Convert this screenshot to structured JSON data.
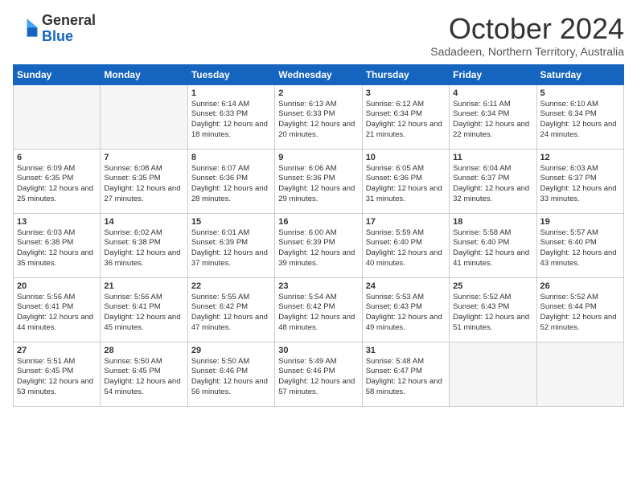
{
  "logo": {
    "line1": "General",
    "line2": "Blue"
  },
  "title": "October 2024",
  "location": "Sadadeen, Northern Territory, Australia",
  "weekdays": [
    "Sunday",
    "Monday",
    "Tuesday",
    "Wednesday",
    "Thursday",
    "Friday",
    "Saturday"
  ],
  "weeks": [
    [
      {
        "day": "",
        "info": ""
      },
      {
        "day": "",
        "info": ""
      },
      {
        "day": "1",
        "info": "Sunrise: 6:14 AM\nSunset: 6:33 PM\nDaylight: 12 hours and 18 minutes."
      },
      {
        "day": "2",
        "info": "Sunrise: 6:13 AM\nSunset: 6:33 PM\nDaylight: 12 hours and 20 minutes."
      },
      {
        "day": "3",
        "info": "Sunrise: 6:12 AM\nSunset: 6:34 PM\nDaylight: 12 hours and 21 minutes."
      },
      {
        "day": "4",
        "info": "Sunrise: 6:11 AM\nSunset: 6:34 PM\nDaylight: 12 hours and 22 minutes."
      },
      {
        "day": "5",
        "info": "Sunrise: 6:10 AM\nSunset: 6:34 PM\nDaylight: 12 hours and 24 minutes."
      }
    ],
    [
      {
        "day": "6",
        "info": "Sunrise: 6:09 AM\nSunset: 6:35 PM\nDaylight: 12 hours and 25 minutes."
      },
      {
        "day": "7",
        "info": "Sunrise: 6:08 AM\nSunset: 6:35 PM\nDaylight: 12 hours and 27 minutes."
      },
      {
        "day": "8",
        "info": "Sunrise: 6:07 AM\nSunset: 6:36 PM\nDaylight: 12 hours and 28 minutes."
      },
      {
        "day": "9",
        "info": "Sunrise: 6:06 AM\nSunset: 6:36 PM\nDaylight: 12 hours and 29 minutes."
      },
      {
        "day": "10",
        "info": "Sunrise: 6:05 AM\nSunset: 6:36 PM\nDaylight: 12 hours and 31 minutes."
      },
      {
        "day": "11",
        "info": "Sunrise: 6:04 AM\nSunset: 6:37 PM\nDaylight: 12 hours and 32 minutes."
      },
      {
        "day": "12",
        "info": "Sunrise: 6:03 AM\nSunset: 6:37 PM\nDaylight: 12 hours and 33 minutes."
      }
    ],
    [
      {
        "day": "13",
        "info": "Sunrise: 6:03 AM\nSunset: 6:38 PM\nDaylight: 12 hours and 35 minutes."
      },
      {
        "day": "14",
        "info": "Sunrise: 6:02 AM\nSunset: 6:38 PM\nDaylight: 12 hours and 36 minutes."
      },
      {
        "day": "15",
        "info": "Sunrise: 6:01 AM\nSunset: 6:39 PM\nDaylight: 12 hours and 37 minutes."
      },
      {
        "day": "16",
        "info": "Sunrise: 6:00 AM\nSunset: 6:39 PM\nDaylight: 12 hours and 39 minutes."
      },
      {
        "day": "17",
        "info": "Sunrise: 5:59 AM\nSunset: 6:40 PM\nDaylight: 12 hours and 40 minutes."
      },
      {
        "day": "18",
        "info": "Sunrise: 5:58 AM\nSunset: 6:40 PM\nDaylight: 12 hours and 41 minutes."
      },
      {
        "day": "19",
        "info": "Sunrise: 5:57 AM\nSunset: 6:40 PM\nDaylight: 12 hours and 43 minutes."
      }
    ],
    [
      {
        "day": "20",
        "info": "Sunrise: 5:56 AM\nSunset: 6:41 PM\nDaylight: 12 hours and 44 minutes."
      },
      {
        "day": "21",
        "info": "Sunrise: 5:56 AM\nSunset: 6:41 PM\nDaylight: 12 hours and 45 minutes."
      },
      {
        "day": "22",
        "info": "Sunrise: 5:55 AM\nSunset: 6:42 PM\nDaylight: 12 hours and 47 minutes."
      },
      {
        "day": "23",
        "info": "Sunrise: 5:54 AM\nSunset: 6:42 PM\nDaylight: 12 hours and 48 minutes."
      },
      {
        "day": "24",
        "info": "Sunrise: 5:53 AM\nSunset: 6:43 PM\nDaylight: 12 hours and 49 minutes."
      },
      {
        "day": "25",
        "info": "Sunrise: 5:52 AM\nSunset: 6:43 PM\nDaylight: 12 hours and 51 minutes."
      },
      {
        "day": "26",
        "info": "Sunrise: 5:52 AM\nSunset: 6:44 PM\nDaylight: 12 hours and 52 minutes."
      }
    ],
    [
      {
        "day": "27",
        "info": "Sunrise: 5:51 AM\nSunset: 6:45 PM\nDaylight: 12 hours and 53 minutes."
      },
      {
        "day": "28",
        "info": "Sunrise: 5:50 AM\nSunset: 6:45 PM\nDaylight: 12 hours and 54 minutes."
      },
      {
        "day": "29",
        "info": "Sunrise: 5:50 AM\nSunset: 6:46 PM\nDaylight: 12 hours and 56 minutes."
      },
      {
        "day": "30",
        "info": "Sunrise: 5:49 AM\nSunset: 6:46 PM\nDaylight: 12 hours and 57 minutes."
      },
      {
        "day": "31",
        "info": "Sunrise: 5:48 AM\nSunset: 6:47 PM\nDaylight: 12 hours and 58 minutes."
      },
      {
        "day": "",
        "info": ""
      },
      {
        "day": "",
        "info": ""
      }
    ]
  ]
}
